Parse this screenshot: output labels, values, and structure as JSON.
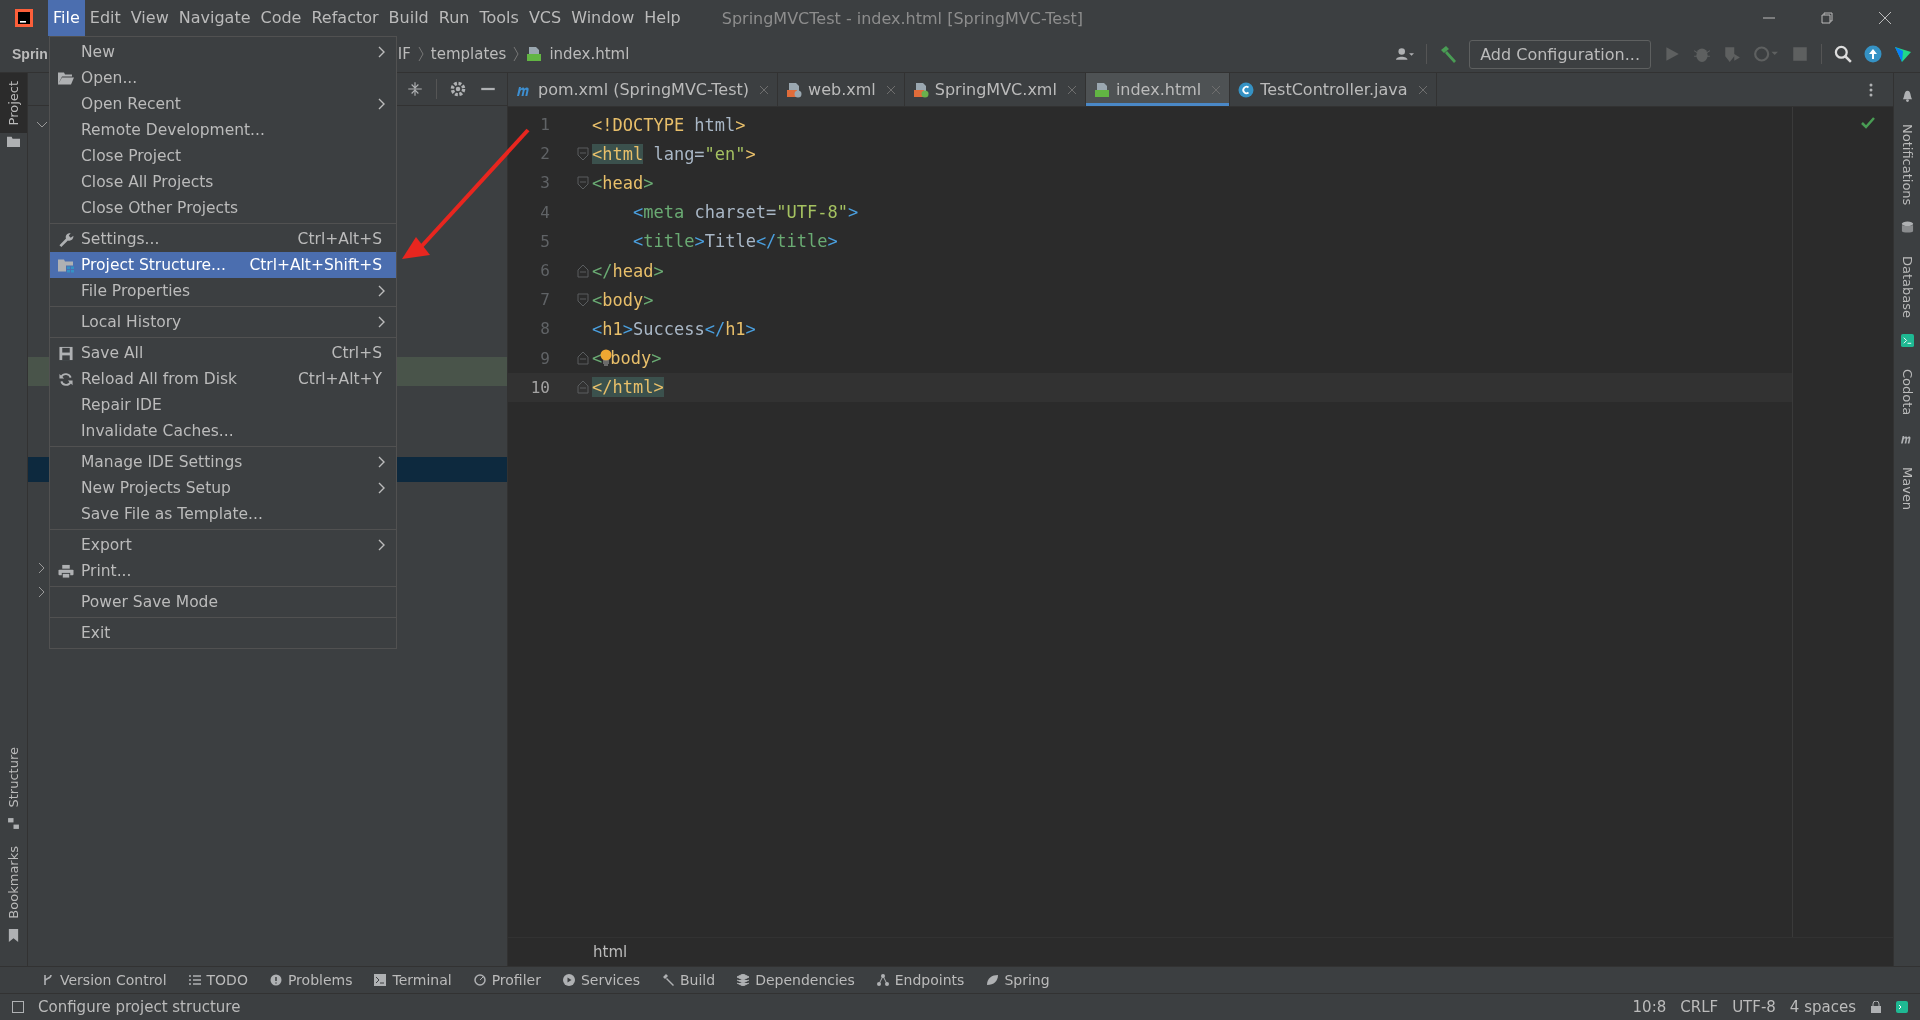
{
  "window": {
    "title": "SpringMVCTest - index.html [SpringMVC-Test]"
  },
  "menubar": [
    {
      "label": "File",
      "selected": true
    },
    {
      "label": "Edit",
      "selected": false
    },
    {
      "label": "View",
      "selected": false
    },
    {
      "label": "Navigate",
      "selected": false
    },
    {
      "label": "Code",
      "selected": false
    },
    {
      "label": "Refactor",
      "selected": false
    },
    {
      "label": "Build",
      "selected": false
    },
    {
      "label": "Run",
      "selected": false
    },
    {
      "label": "Tools",
      "selected": false
    },
    {
      "label": "VCS",
      "selected": false
    },
    {
      "label": "Window",
      "selected": false
    },
    {
      "label": "Help",
      "selected": false
    }
  ],
  "breadcrumbs": [
    {
      "label": "Sprin"
    },
    {
      "label": "IF"
    },
    {
      "label": "templates"
    },
    {
      "label": "index.html"
    }
  ],
  "toolbar": {
    "run_config": "Add Configuration..."
  },
  "menu": {
    "items": [
      {
        "kind": "item",
        "label": "New",
        "submenu": true,
        "selected": false
      },
      {
        "kind": "item",
        "label": "Open...",
        "selected": false
      },
      {
        "kind": "item",
        "label": "Open Recent",
        "submenu": true,
        "selected": false
      },
      {
        "kind": "item",
        "label": "Remote Development...",
        "selected": false
      },
      {
        "kind": "item",
        "label": "Close Project",
        "selected": false
      },
      {
        "kind": "item",
        "label": "Close All Projects",
        "selected": false
      },
      {
        "kind": "item",
        "label": "Close Other Projects",
        "selected": false
      },
      {
        "kind": "separator"
      },
      {
        "kind": "item",
        "label": "Settings...",
        "shortcut": "Ctrl+Alt+S",
        "selected": false
      },
      {
        "kind": "item",
        "label": "Project Structure...",
        "shortcut": "Ctrl+Alt+Shift+S",
        "selected": true
      },
      {
        "kind": "item",
        "label": "File Properties",
        "submenu": true,
        "selected": false
      },
      {
        "kind": "separator"
      },
      {
        "kind": "item",
        "label": "Local History",
        "submenu": true,
        "selected": false
      },
      {
        "kind": "separator"
      },
      {
        "kind": "item",
        "label": "Save All",
        "shortcut": "Ctrl+S",
        "selected": false
      },
      {
        "kind": "item",
        "label": "Reload All from Disk",
        "shortcut": "Ctrl+Alt+Y",
        "selected": false
      },
      {
        "kind": "item",
        "label": "Repair IDE",
        "selected": false
      },
      {
        "kind": "item",
        "label": "Invalidate Caches...",
        "selected": false
      },
      {
        "kind": "separator"
      },
      {
        "kind": "item",
        "label": "Manage IDE Settings",
        "submenu": true,
        "selected": false
      },
      {
        "kind": "item",
        "label": "New Projects Setup",
        "submenu": true,
        "selected": false
      },
      {
        "kind": "item",
        "label": "Save File as Template...",
        "selected": false
      },
      {
        "kind": "separator"
      },
      {
        "kind": "item",
        "label": "Export",
        "submenu": true,
        "selected": false
      },
      {
        "kind": "item",
        "label": "Print...",
        "selected": false
      },
      {
        "kind": "separator"
      },
      {
        "kind": "item",
        "label": "Power Save Mode",
        "selected": false
      },
      {
        "kind": "separator"
      },
      {
        "kind": "item",
        "label": "Exit",
        "selected": false
      }
    ]
  },
  "left_strip_top": [
    {
      "label": "Project",
      "selected": true
    }
  ],
  "left_strip_bottom": [
    {
      "label": "Structure",
      "selected": false
    },
    {
      "label": "Bookmarks",
      "selected": false
    }
  ],
  "right_strip": [
    {
      "label": "Notifications"
    },
    {
      "label": "Database"
    },
    {
      "label": "Codota"
    },
    {
      "label": "Maven"
    }
  ],
  "tabs": [
    {
      "label": "pom.xml (SpringMVC-Test)",
      "kind": "maven",
      "selected": false
    },
    {
      "label": "web.xml",
      "kind": "xml",
      "selected": false
    },
    {
      "label": "SpringMVC.xml",
      "kind": "spring",
      "selected": false
    },
    {
      "label": "index.html",
      "kind": "html",
      "selected": true
    },
    {
      "label": "TestController.java",
      "kind": "class",
      "selected": false
    }
  ],
  "code": [
    {
      "number": "1",
      "tokens": [
        {
          "kind": "tag",
          "text": "<!DOCTYPE"
        },
        {
          "kind": "text",
          "text": " html"
        },
        {
          "kind": "tag",
          "text": ">"
        }
      ]
    },
    {
      "number": "2",
      "fold": true,
      "fold_end": false,
      "tokens": [
        {
          "kind": "tag",
          "text": "<html",
          "matched": true
        },
        {
          "kind": "text",
          "text": " lang="
        },
        {
          "kind": "string",
          "text": "\"en\""
        },
        {
          "kind": "tag",
          "text": ">"
        }
      ]
    },
    {
      "number": "3",
      "fold": true,
      "fold_end": false,
      "tokens": [
        {
          "kind": "green",
          "text": "<"
        },
        {
          "kind": "tag",
          "text": "head"
        },
        {
          "kind": "green",
          "text": ">"
        }
      ]
    },
    {
      "number": "4",
      "indent": true,
      "tokens": [
        {
          "kind": "blue",
          "text": "<"
        },
        {
          "kind": "green",
          "text": "meta"
        },
        {
          "kind": "text",
          "text": " charset="
        },
        {
          "kind": "string",
          "text": "\"UTF-8\""
        },
        {
          "kind": "blue",
          "text": ">"
        }
      ]
    },
    {
      "number": "5",
      "indent": true,
      "tokens": [
        {
          "kind": "blue",
          "text": "<"
        },
        {
          "kind": "green",
          "text": "title"
        },
        {
          "kind": "blue",
          "text": ">"
        },
        {
          "kind": "text",
          "text": "Title"
        },
        {
          "kind": "blue",
          "text": "</"
        },
        {
          "kind": "green",
          "text": "title"
        },
        {
          "kind": "blue",
          "text": ">"
        }
      ]
    },
    {
      "number": "6",
      "fold": true,
      "fold_end": true,
      "tokens": [
        {
          "kind": "green",
          "text": "</"
        },
        {
          "kind": "tag",
          "text": "head"
        },
        {
          "kind": "green",
          "text": ">"
        }
      ]
    },
    {
      "number": "7",
      "fold": true,
      "fold_end": false,
      "tokens": [
        {
          "kind": "green",
          "text": "<"
        },
        {
          "kind": "tag",
          "text": "body"
        },
        {
          "kind": "green",
          "text": ">"
        }
      ]
    },
    {
      "number": "8",
      "tokens": [
        {
          "kind": "blue",
          "text": "<"
        },
        {
          "kind": "tag",
          "text": "h1"
        },
        {
          "kind": "blue",
          "text": ">"
        },
        {
          "kind": "text",
          "text": "Success"
        },
        {
          "kind": "blue",
          "text": "</"
        },
        {
          "kind": "tag",
          "text": "h1"
        },
        {
          "kind": "blue",
          "text": ">"
        }
      ]
    },
    {
      "number": "9",
      "fold": true,
      "fold_end": true,
      "tokens": [
        {
          "kind": "green",
          "text": "<"
        },
        {
          "kind": "bulb"
        },
        {
          "kind": "tag",
          "text": "body"
        },
        {
          "kind": "green",
          "text": ">"
        }
      ]
    },
    {
      "number": "10",
      "fold": true,
      "fold_end": true,
      "current": true,
      "tokens": [
        {
          "kind": "tag",
          "text": "</html>",
          "matched": true
        }
      ]
    }
  ],
  "editor_breadcrumb": "html",
  "tool_buttons": [
    {
      "label": "Version Control",
      "kind": "branch"
    },
    {
      "label": "TODO",
      "kind": "list"
    },
    {
      "label": "Problems",
      "kind": "alert"
    },
    {
      "label": "Terminal",
      "kind": "terminal"
    },
    {
      "label": "Profiler",
      "kind": "profiler"
    },
    {
      "label": "Services",
      "kind": "play"
    },
    {
      "label": "Build",
      "kind": "hammer"
    },
    {
      "label": "Dependencies",
      "kind": "stack"
    },
    {
      "label": "Endpoints",
      "kind": "nodes"
    },
    {
      "label": "Spring",
      "kind": "leaf"
    }
  ],
  "status_bar": {
    "message": "Configure project structure",
    "items": [
      "10:8",
      "CRLF",
      "UTF-8",
      "4 spaces"
    ]
  }
}
